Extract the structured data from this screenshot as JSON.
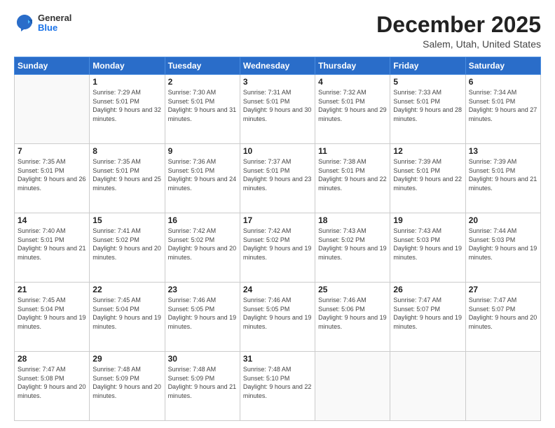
{
  "header": {
    "logo": {
      "general": "General",
      "blue": "Blue"
    },
    "title": "December 2025",
    "location": "Salem, Utah, United States"
  },
  "calendar": {
    "weekdays": [
      "Sunday",
      "Monday",
      "Tuesday",
      "Wednesday",
      "Thursday",
      "Friday",
      "Saturday"
    ],
    "weeks": [
      [
        {
          "day": "",
          "sunrise": "",
          "sunset": "",
          "daylight": ""
        },
        {
          "day": "1",
          "sunrise": "Sunrise: 7:29 AM",
          "sunset": "Sunset: 5:01 PM",
          "daylight": "Daylight: 9 hours and 32 minutes."
        },
        {
          "day": "2",
          "sunrise": "Sunrise: 7:30 AM",
          "sunset": "Sunset: 5:01 PM",
          "daylight": "Daylight: 9 hours and 31 minutes."
        },
        {
          "day": "3",
          "sunrise": "Sunrise: 7:31 AM",
          "sunset": "Sunset: 5:01 PM",
          "daylight": "Daylight: 9 hours and 30 minutes."
        },
        {
          "day": "4",
          "sunrise": "Sunrise: 7:32 AM",
          "sunset": "Sunset: 5:01 PM",
          "daylight": "Daylight: 9 hours and 29 minutes."
        },
        {
          "day": "5",
          "sunrise": "Sunrise: 7:33 AM",
          "sunset": "Sunset: 5:01 PM",
          "daylight": "Daylight: 9 hours and 28 minutes."
        },
        {
          "day": "6",
          "sunrise": "Sunrise: 7:34 AM",
          "sunset": "Sunset: 5:01 PM",
          "daylight": "Daylight: 9 hours and 27 minutes."
        }
      ],
      [
        {
          "day": "7",
          "sunrise": "Sunrise: 7:35 AM",
          "sunset": "Sunset: 5:01 PM",
          "daylight": "Daylight: 9 hours and 26 minutes."
        },
        {
          "day": "8",
          "sunrise": "Sunrise: 7:35 AM",
          "sunset": "Sunset: 5:01 PM",
          "daylight": "Daylight: 9 hours and 25 minutes."
        },
        {
          "day": "9",
          "sunrise": "Sunrise: 7:36 AM",
          "sunset": "Sunset: 5:01 PM",
          "daylight": "Daylight: 9 hours and 24 minutes."
        },
        {
          "day": "10",
          "sunrise": "Sunrise: 7:37 AM",
          "sunset": "Sunset: 5:01 PM",
          "daylight": "Daylight: 9 hours and 23 minutes."
        },
        {
          "day": "11",
          "sunrise": "Sunrise: 7:38 AM",
          "sunset": "Sunset: 5:01 PM",
          "daylight": "Daylight: 9 hours and 22 minutes."
        },
        {
          "day": "12",
          "sunrise": "Sunrise: 7:39 AM",
          "sunset": "Sunset: 5:01 PM",
          "daylight": "Daylight: 9 hours and 22 minutes."
        },
        {
          "day": "13",
          "sunrise": "Sunrise: 7:39 AM",
          "sunset": "Sunset: 5:01 PM",
          "daylight": "Daylight: 9 hours and 21 minutes."
        }
      ],
      [
        {
          "day": "14",
          "sunrise": "Sunrise: 7:40 AM",
          "sunset": "Sunset: 5:01 PM",
          "daylight": "Daylight: 9 hours and 21 minutes."
        },
        {
          "day": "15",
          "sunrise": "Sunrise: 7:41 AM",
          "sunset": "Sunset: 5:02 PM",
          "daylight": "Daylight: 9 hours and 20 minutes."
        },
        {
          "day": "16",
          "sunrise": "Sunrise: 7:42 AM",
          "sunset": "Sunset: 5:02 PM",
          "daylight": "Daylight: 9 hours and 20 minutes."
        },
        {
          "day": "17",
          "sunrise": "Sunrise: 7:42 AM",
          "sunset": "Sunset: 5:02 PM",
          "daylight": "Daylight: 9 hours and 19 minutes."
        },
        {
          "day": "18",
          "sunrise": "Sunrise: 7:43 AM",
          "sunset": "Sunset: 5:02 PM",
          "daylight": "Daylight: 9 hours and 19 minutes."
        },
        {
          "day": "19",
          "sunrise": "Sunrise: 7:43 AM",
          "sunset": "Sunset: 5:03 PM",
          "daylight": "Daylight: 9 hours and 19 minutes."
        },
        {
          "day": "20",
          "sunrise": "Sunrise: 7:44 AM",
          "sunset": "Sunset: 5:03 PM",
          "daylight": "Daylight: 9 hours and 19 minutes."
        }
      ],
      [
        {
          "day": "21",
          "sunrise": "Sunrise: 7:45 AM",
          "sunset": "Sunset: 5:04 PM",
          "daylight": "Daylight: 9 hours and 19 minutes."
        },
        {
          "day": "22",
          "sunrise": "Sunrise: 7:45 AM",
          "sunset": "Sunset: 5:04 PM",
          "daylight": "Daylight: 9 hours and 19 minutes."
        },
        {
          "day": "23",
          "sunrise": "Sunrise: 7:46 AM",
          "sunset": "Sunset: 5:05 PM",
          "daylight": "Daylight: 9 hours and 19 minutes."
        },
        {
          "day": "24",
          "sunrise": "Sunrise: 7:46 AM",
          "sunset": "Sunset: 5:05 PM",
          "daylight": "Daylight: 9 hours and 19 minutes."
        },
        {
          "day": "25",
          "sunrise": "Sunrise: 7:46 AM",
          "sunset": "Sunset: 5:06 PM",
          "daylight": "Daylight: 9 hours and 19 minutes."
        },
        {
          "day": "26",
          "sunrise": "Sunrise: 7:47 AM",
          "sunset": "Sunset: 5:07 PM",
          "daylight": "Daylight: 9 hours and 19 minutes."
        },
        {
          "day": "27",
          "sunrise": "Sunrise: 7:47 AM",
          "sunset": "Sunset: 5:07 PM",
          "daylight": "Daylight: 9 hours and 20 minutes."
        }
      ],
      [
        {
          "day": "28",
          "sunrise": "Sunrise: 7:47 AM",
          "sunset": "Sunset: 5:08 PM",
          "daylight": "Daylight: 9 hours and 20 minutes."
        },
        {
          "day": "29",
          "sunrise": "Sunrise: 7:48 AM",
          "sunset": "Sunset: 5:09 PM",
          "daylight": "Daylight: 9 hours and 20 minutes."
        },
        {
          "day": "30",
          "sunrise": "Sunrise: 7:48 AM",
          "sunset": "Sunset: 5:09 PM",
          "daylight": "Daylight: 9 hours and 21 minutes."
        },
        {
          "day": "31",
          "sunrise": "Sunrise: 7:48 AM",
          "sunset": "Sunset: 5:10 PM",
          "daylight": "Daylight: 9 hours and 22 minutes."
        },
        {
          "day": "",
          "sunrise": "",
          "sunset": "",
          "daylight": ""
        },
        {
          "day": "",
          "sunrise": "",
          "sunset": "",
          "daylight": ""
        },
        {
          "day": "",
          "sunrise": "",
          "sunset": "",
          "daylight": ""
        }
      ]
    ]
  }
}
